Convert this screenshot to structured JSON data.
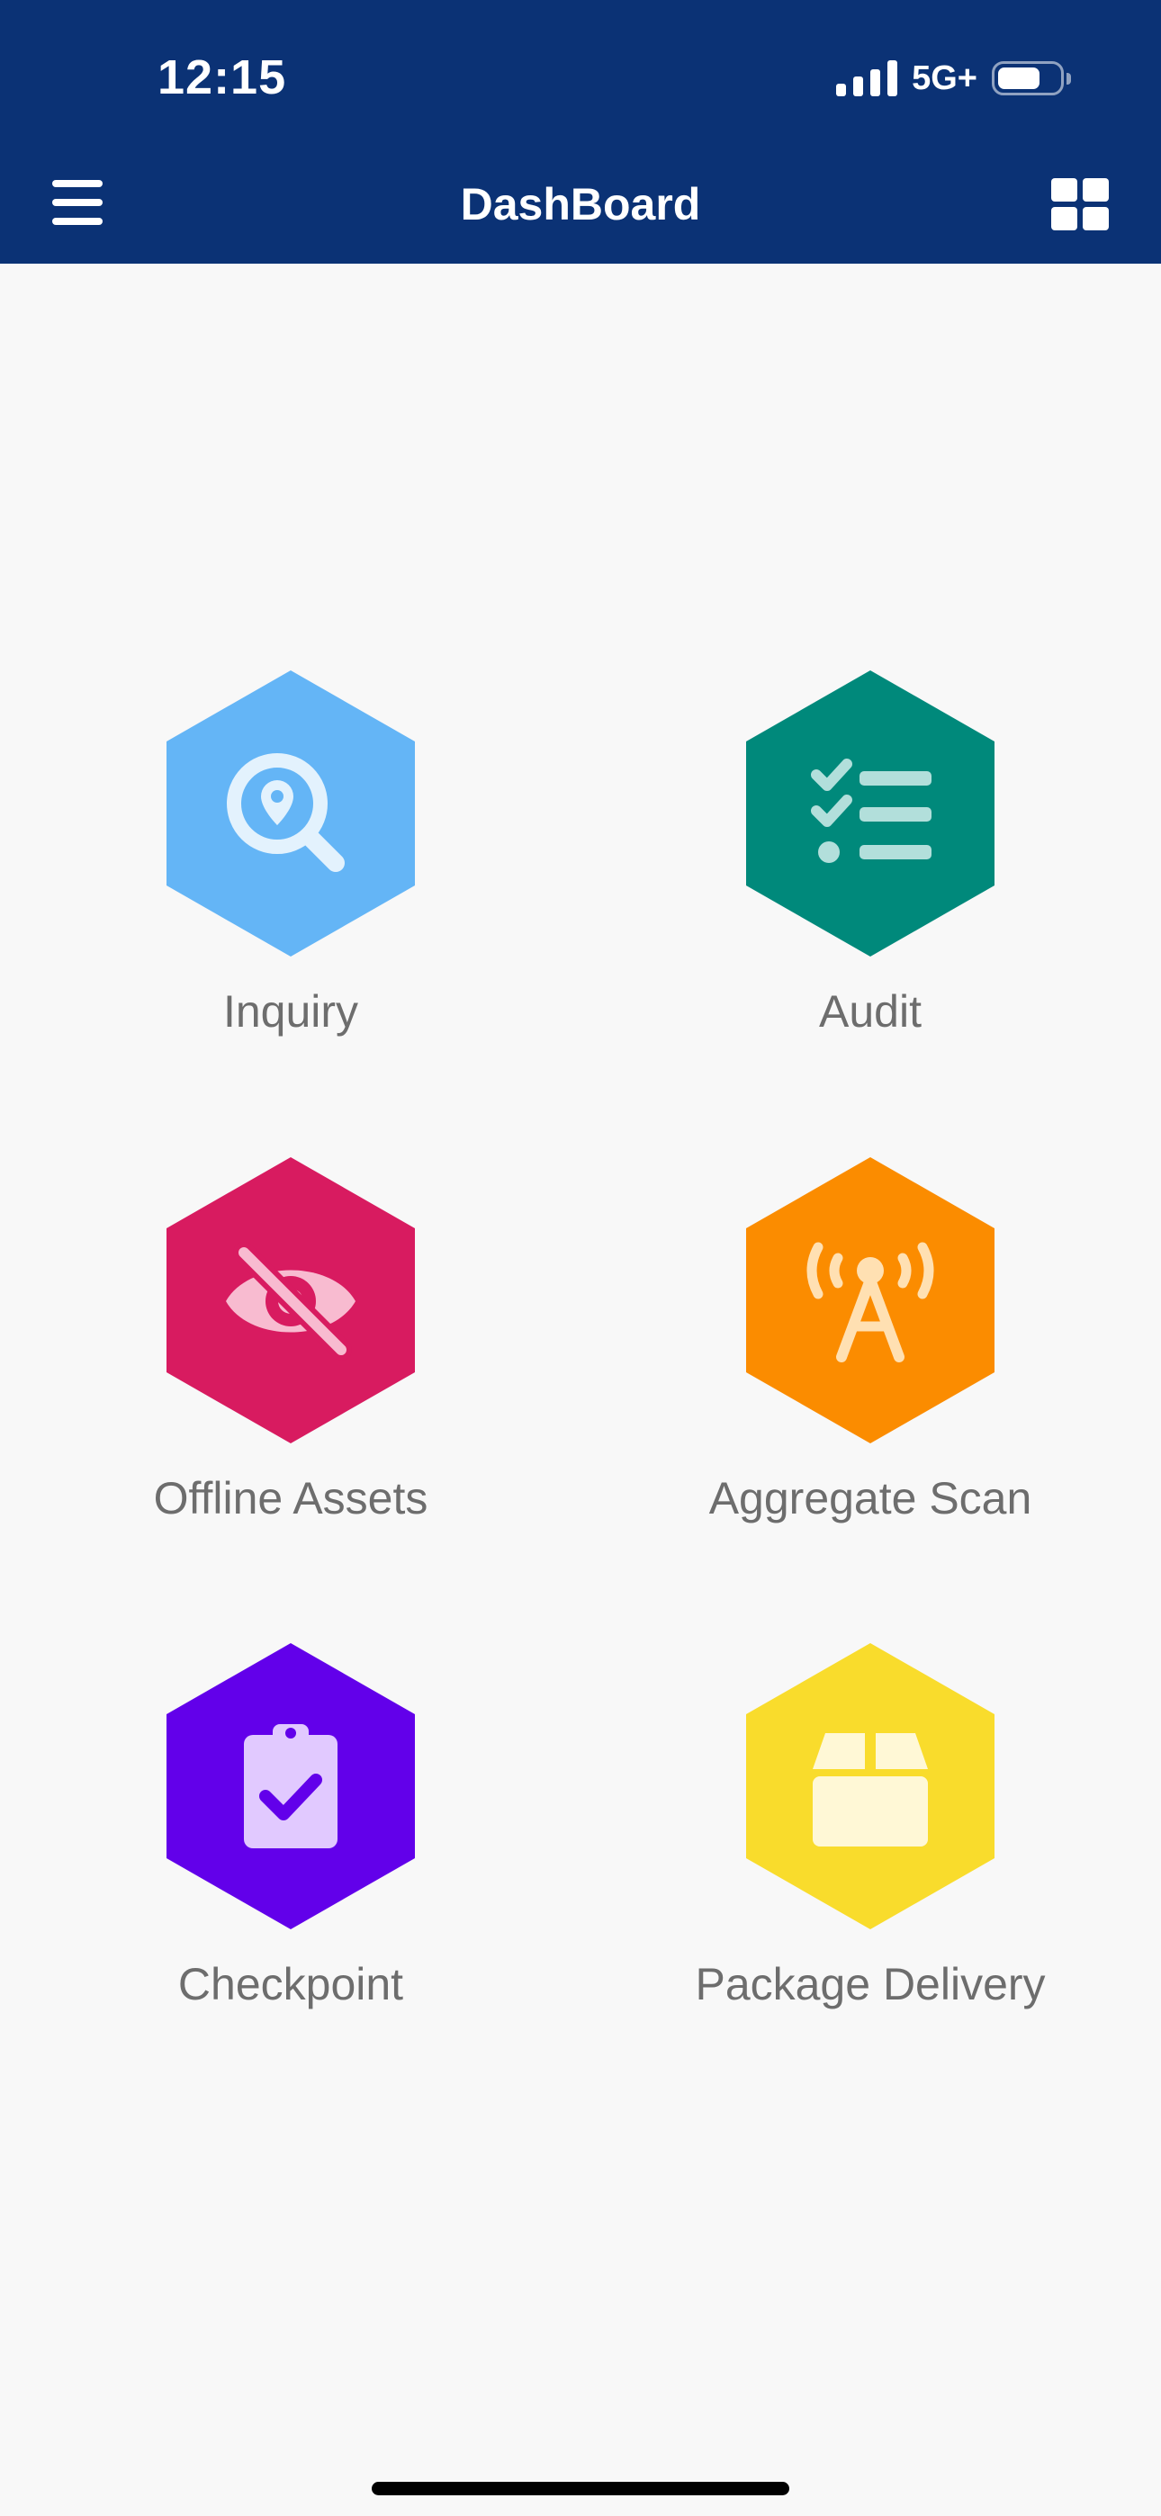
{
  "status_bar": {
    "time": "12:15",
    "network": "5G+"
  },
  "header": {
    "title": "DashBoard"
  },
  "tiles": [
    {
      "label": "Inquiry",
      "color": "#64b5f6",
      "icon": "location-search-icon"
    },
    {
      "label": "Audit",
      "color": "#00897b",
      "icon": "checklist-icon"
    },
    {
      "label": "Offline Assets",
      "color": "#d81b60",
      "icon": "eye-off-icon"
    },
    {
      "label": "Aggregate Scan",
      "color": "#fb8c00",
      "icon": "broadcast-tower-icon"
    },
    {
      "label": "Checkpoint",
      "color": "#6200ea",
      "icon": "clipboard-check-icon"
    },
    {
      "label": "Package Delivery",
      "color": "#f9dc2c",
      "icon": "package-icon"
    }
  ],
  "colors": {
    "header_bg": "#0b3275",
    "page_bg": "#f8f8f8",
    "label_text": "#6d6d6d"
  }
}
